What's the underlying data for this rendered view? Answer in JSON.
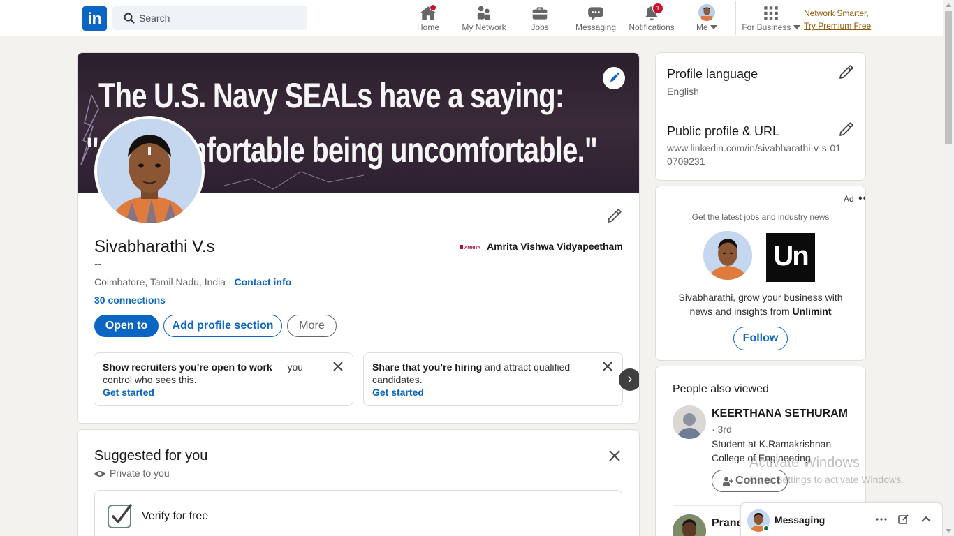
{
  "header": {
    "logo_text": "in",
    "search_placeholder": "Search",
    "nav": [
      {
        "label": "Home",
        "icon": "home-icon",
        "badge": ""
      },
      {
        "label": "My Network",
        "icon": "people-icon",
        "badge": ""
      },
      {
        "label": "Jobs",
        "icon": "briefcase-icon",
        "badge": ""
      },
      {
        "label": "Messaging",
        "icon": "chat-icon",
        "badge": ""
      },
      {
        "label": "Notifications",
        "icon": "bell-icon",
        "badge": "1"
      },
      {
        "label": "Me",
        "icon": "avatar-icon",
        "badge": ""
      },
      {
        "label": "For Business",
        "icon": "grid-icon",
        "badge": ""
      }
    ],
    "premium_line1": "Network Smarter,",
    "premium_line2": "Try Premium Free"
  },
  "profile": {
    "banner_line1": "The U.S. Navy SEALs have a saying:",
    "banner_line2": "\"Get comfortable being uncomfortable.\"",
    "name": "Sivabharathi V.s",
    "headline": "--",
    "location": "Coimbatore, Tamil Nadu, India",
    "location_sep": " · ",
    "contact_info": "Contact info",
    "connections": "30 connections",
    "school": "Amrita Vishwa Vidyapeetham",
    "school_logo_text": "AMRITA",
    "buttons": {
      "open_to": "Open to",
      "add_section": "Add profile section",
      "more": "More"
    },
    "promos": [
      {
        "bold": "Show recruiters you’re open to work",
        "rest": " — you control who sees this.",
        "cta": "Get started"
      },
      {
        "bold": "Share that you’re hiring",
        "rest": " and attract qualified candidates.",
        "cta": "Get started"
      }
    ],
    "next_glyph": "›"
  },
  "suggested": {
    "title": "Suggested for you",
    "privacy": "Private to you",
    "verify": "Verify for free"
  },
  "sidebar": {
    "language_title": "Profile language",
    "language_value": "English",
    "url_title": "Public profile & URL",
    "url_value": "www.linkedin.com/in/sivabharathi-v-s-010709231"
  },
  "ad": {
    "label": "Ad",
    "more": "•••",
    "tagline": "Get the latest jobs and industry news",
    "brand_mark": "Un",
    "text_prefix": "Sivabharathi, grow your business with news and insights from ",
    "text_brand": "Unlimint",
    "follow": "Follow"
  },
  "people_also_viewed": {
    "title": "People also viewed",
    "people": [
      {
        "name": "KEERTHANA SETHURAM",
        "degree": "· 3rd",
        "headline": "Student at K.Ramakrishnan College of Engineering",
        "action": "Connect"
      },
      {
        "name": "Prane"
      }
    ]
  },
  "watermark": {
    "line1": "Activate Windows",
    "line2": "Go to Settings to activate Windows."
  },
  "messaging": {
    "title": "Messaging"
  },
  "colors": {
    "brand": "#0a66c2",
    "premium": "#915907",
    "badge": "#cb112d",
    "online": "#057642"
  }
}
